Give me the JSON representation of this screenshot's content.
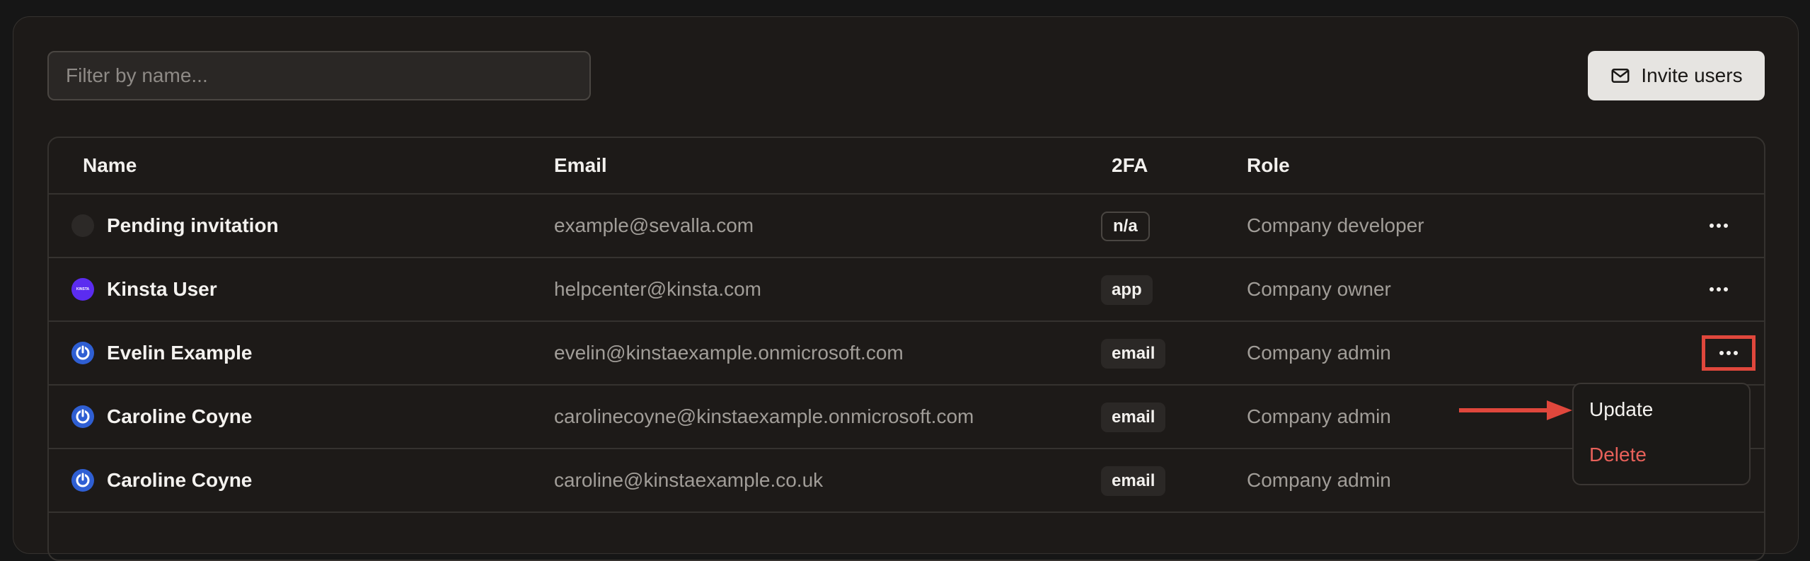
{
  "filter": {
    "placeholder": "Filter by name..."
  },
  "invite_button": {
    "label": "Invite users",
    "icon": "mail-icon"
  },
  "table": {
    "headers": {
      "name": "Name",
      "email": "Email",
      "twofa": "2FA",
      "role": "Role"
    },
    "rows": [
      {
        "avatar": "empty",
        "name": "Pending invitation",
        "email": "example@sevalla.com",
        "twofa": "n/a",
        "role": "Company developer"
      },
      {
        "avatar": "kinsta",
        "avatar_text": "KINSTA",
        "name": "Kinsta User",
        "email": "helpcenter@kinsta.com",
        "twofa": "app",
        "role": "Company owner"
      },
      {
        "avatar": "power",
        "name": "Evelin Example",
        "email": "evelin@kinstaexample.onmicrosoft.com",
        "twofa": "email",
        "role": "Company admin"
      },
      {
        "avatar": "power",
        "name": "Caroline Coyne",
        "email": "carolinecoyne@kinstaexample.onmicrosoft.com",
        "twofa": "email",
        "role": "Company admin"
      },
      {
        "avatar": "power",
        "name": "Caroline Coyne",
        "email": "caroline@kinstaexample.co.uk",
        "twofa": "email",
        "role": "Company admin"
      }
    ]
  },
  "actions_menu": {
    "update": "Update",
    "delete": "Delete"
  },
  "colors": {
    "annotation": "#e0473c",
    "danger": "#e8615a",
    "kinsta_purple": "#5b2cf0",
    "power_blue": "#2f5fd3"
  }
}
